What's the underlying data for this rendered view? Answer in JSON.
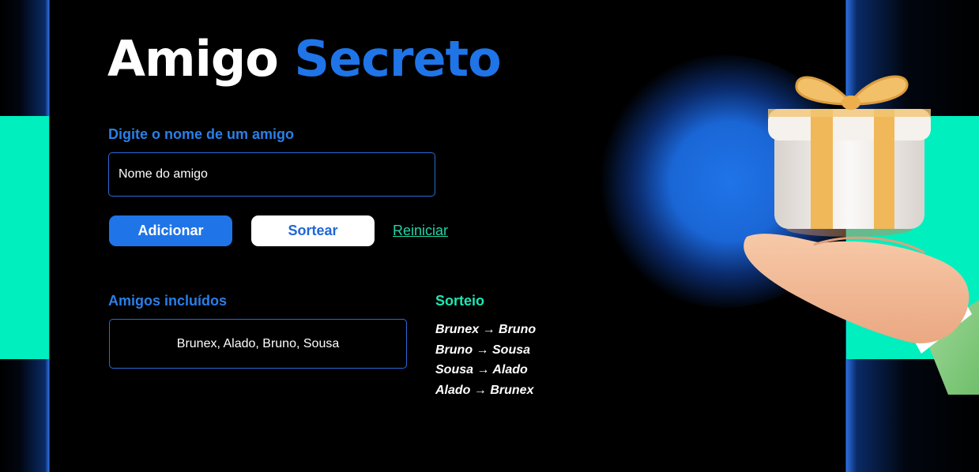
{
  "title": {
    "word1": "Amigo",
    "word2": "Secreto"
  },
  "input": {
    "label": "Digite o nome de um amigo",
    "placeholder": "Nome do amigo"
  },
  "buttons": {
    "add": "Adicionar",
    "draw": "Sortear",
    "reset": "Reiniciar"
  },
  "friends": {
    "heading": "Amigos incluídos",
    "list_text": "Brunex, Alado, Bruno, Sousa"
  },
  "result": {
    "heading": "Sorteio",
    "pairs": [
      "Brunex → Bruno",
      "Bruno → Sousa",
      "Sousa → Alado",
      "Alado → Brunex"
    ]
  },
  "icons": {
    "illustration": "gift-on-hand-icon"
  },
  "colors": {
    "accent_blue": "#1f74e8",
    "mint": "#00efbf",
    "background": "#000000",
    "result_heading": "#1ee6b2"
  }
}
